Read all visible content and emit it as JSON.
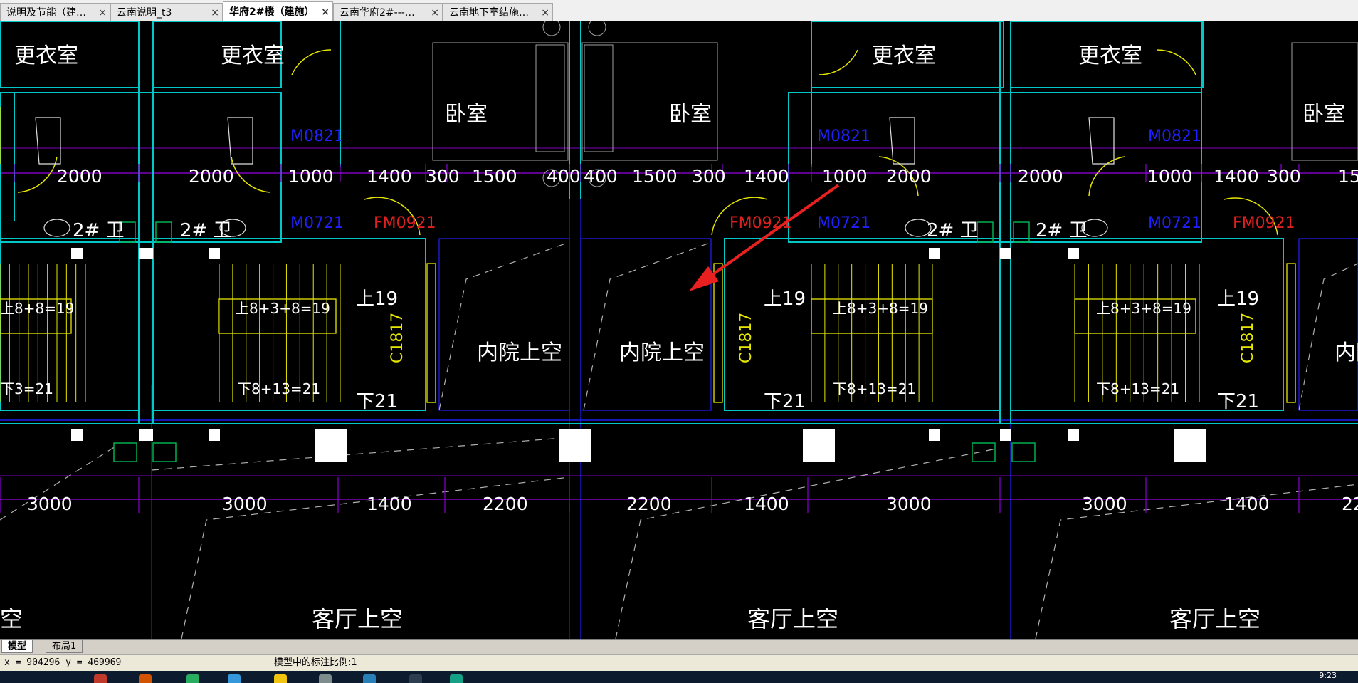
{
  "tabs": [
    {
      "label": "说明及节能（建…",
      "active": false
    },
    {
      "label": "云南说明_t3",
      "active": false
    },
    {
      "label": "华府2#楼（建施）",
      "active": true
    },
    {
      "label": "云南华府2#---…",
      "active": false
    },
    {
      "label": "云南地下室结施…",
      "active": false
    }
  ],
  "drawing": {
    "room_labels": [
      "更衣室",
      "更衣室",
      "更衣室",
      "更衣室",
      "卧室",
      "卧室",
      "卧室"
    ],
    "dims_top": [
      "2000",
      "2000",
      "1000",
      "1400",
      "300",
      "1500",
      "400",
      "400",
      "1500",
      "300",
      "1400",
      "1000",
      "2000",
      "2000",
      "1000",
      "1400",
      "300",
      "15"
    ],
    "door_tags_blue": [
      "M0821",
      "M0721",
      "M0821",
      "M0721",
      "M0821",
      "M0721"
    ],
    "door_tags_red": [
      "FM0921",
      "FM0921",
      "FM0921"
    ],
    "toilet_labels": [
      "2# 卫",
      "2# 卫",
      "2# 卫",
      "2# 卫"
    ],
    "stair_labels": [
      "上19",
      "上19",
      "上19",
      "下21",
      "下21",
      "下21"
    ],
    "stair_text": [
      "上8+8=19",
      "上8+3+8=19",
      "上8+3+8=19",
      "上8+3+8=19",
      "下3=21",
      "下8+13=21",
      "下8+13=21",
      "下8+13=21"
    ],
    "c_tags": [
      "C1817",
      "C1817",
      "C1817"
    ],
    "courtyard": [
      "内院上空",
      "内院上空",
      "内院"
    ],
    "dims_bottom": [
      "3000",
      "3000",
      "1400",
      "2200",
      "2200",
      "1400",
      "3000",
      "3000",
      "1400",
      "22"
    ],
    "living": [
      "空",
      "客厅上空",
      "客厅上空",
      "客厅上空"
    ]
  },
  "layout_tabs": [
    "模型",
    "布局1"
  ],
  "status": {
    "coords": "x = 904296  y = 469969",
    "scale_text": "模型中的标注比例:1"
  },
  "taskbar": {
    "clock": "9:23"
  },
  "colors": {
    "cyan": "#00c8c8",
    "yellow": "#e6e600",
    "purple": "#8000c0",
    "blue": "#2020ff",
    "red": "#e02020",
    "white": "#ffffff",
    "green": "#00b050"
  }
}
